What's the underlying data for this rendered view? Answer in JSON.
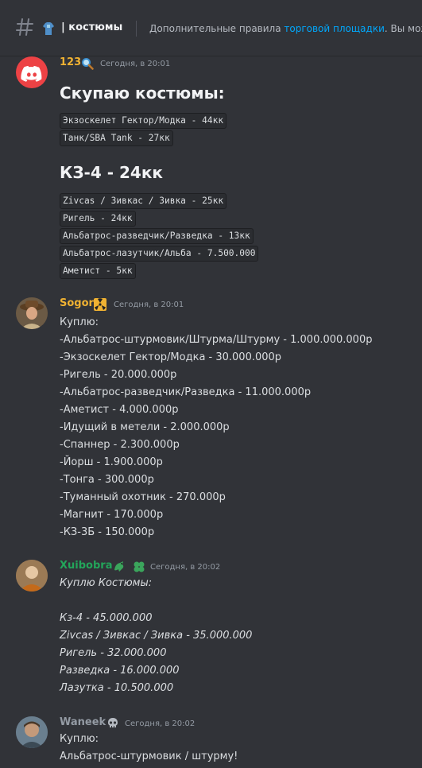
{
  "header": {
    "channel_name": "костюмы",
    "topic_prefix": "Дополнительные правила ",
    "topic_link": "торговой площадки",
    "topic_suffix": ". Вы мож"
  },
  "messages": [
    {
      "author": "123",
      "author_color": "#f0b232",
      "timestamp": "Сегодня, в 20:01",
      "heading1": "Скупаю костюмы:",
      "code1": [
        "Экзоскелет Гектор/Модка - 44кк",
        "Танк/SBA Tank - 27кк"
      ],
      "heading2": "КЗ-4 - 24кк",
      "code2": [
        "Zivcas / Зивкас / Зивка - 25кк",
        "Ригель - 24кк",
        "Альбатрос-разведчик/Разведка - 13кк",
        "Альбатрос-лазутчик/Альба - 7.500.000",
        "Аметист - 5кк"
      ]
    },
    {
      "author": "Sogor",
      "author_color": "#f0b232",
      "timestamp": "Сегодня, в 20:01",
      "lines": [
        "Куплю:",
        "-Альбатрос-штурмовик/Штурма/Штурму - 1.000.000.000р",
        "-Экзоскелет Гектор/Модка - 30.000.000р",
        "-Ригель - 20.000.000р",
        "-Альбатрос-разведчик/Разведка - 11.000.000р",
        "-Аметист - 4.000.000р",
        "-Идущий в метели - 2.000.000р",
        "-Спаннер - 2.300.000р",
        "-Йорш - 1.900.000р",
        "-Тонга - 300.000р",
        "-Туманный охотник - 270.000р",
        "-Магнит - 170.000р",
        "-КЗ-3Б - 150.000р"
      ]
    },
    {
      "author": "Xuibobra",
      "author_color": "#23a55a",
      "timestamp": "Сегодня, в 20:02",
      "lines": [
        "Куплю Костюмы:",
        "Кз-4 - 45.000.000",
        "Zivcas / Зивкас / Зивка - 35.000.000",
        "Ригель - 32.000.000",
        "Разведка - 16.000.000",
        "Лазутка - 10.500.000"
      ]
    },
    {
      "author": "Waneek",
      "author_color": "#949ba4",
      "timestamp": "Сегодня, в 20:02",
      "lines": [
        "Куплю:",
        "Альбатрос-штурмовик / штурму!"
      ]
    }
  ]
}
